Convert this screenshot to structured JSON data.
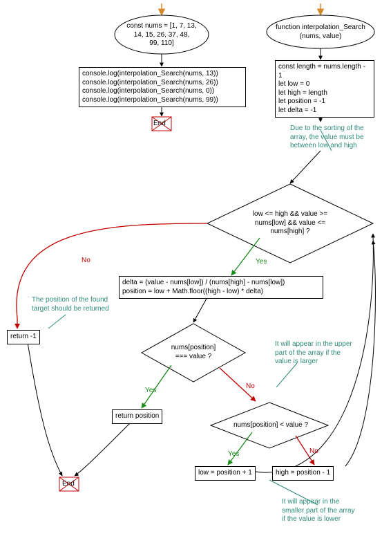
{
  "left": {
    "start_array": "const nums = [1, 7, 13,\n14, 15, 26, 37, 48,\n99, 110]",
    "calls": "console.log(interpolation_Search(nums, 13))\nconsole.log(interpolation_Search(nums, 26))\nconsole.log(interpolation_Search(nums, 0))\nconsole.log(interpolation_Search(nums, 99))",
    "end": "End"
  },
  "right": {
    "func_header": "function interpolation_Search\n(nums, value)",
    "init_block": "const length = nums.length - 1\nlet low = 0\nlet high = length\nlet position = -1\nlet delta = -1"
  },
  "comments": {
    "sort_note": "Due to the sorting of the\narray, the value must be\nbetween low and high",
    "found_note": "The position of the found\ntarget should be returned",
    "upper_note": "It will appear in the upper\npart of the array if the\nvalue is larger",
    "lower_note": "It will appear in the\nsmaller part of the array\nif the value is lower"
  },
  "cond_while": "low <= high && value >=\nnums[low] && value <=\nnums[high] ?",
  "calc_block": "delta = (value - nums[low]) / (nums[high] - nums[low])\nposition = low + Math.floor((high - low) * delta)",
  "cond_match": "nums[position]\n=== value ?",
  "cond_less": "nums[position] < value ?",
  "ret_neg1": "return -1",
  "ret_pos": "return position",
  "low_update": "low = position + 1",
  "high_update": "high = position - 1",
  "edge": {
    "yes": "Yes",
    "no": "No"
  },
  "end": "End",
  "chart_data": {
    "type": "flowchart",
    "nodes": [
      {
        "id": "n_start_left",
        "kind": "terminator",
        "label": "const nums = [1, 7, 13, 14, 15, 26, 37, 48, 99, 110]"
      },
      {
        "id": "n_calls",
        "kind": "process",
        "label": "console.log(interpolation_Search(nums, 13)); console.log(interpolation_Search(nums, 26)); console.log(interpolation_Search(nums, 0)); console.log(interpolation_Search(nums, 99))"
      },
      {
        "id": "n_end_left",
        "kind": "end",
        "label": "End"
      },
      {
        "id": "n_func",
        "kind": "terminator",
        "label": "function interpolation_Search(nums, value)"
      },
      {
        "id": "n_init",
        "kind": "process",
        "label": "const length = nums.length - 1; let low = 0; let high = length; let position = -1; let delta = -1"
      },
      {
        "id": "n_while",
        "kind": "decision",
        "label": "low <= high && value >= nums[low] && value <= nums[high] ?"
      },
      {
        "id": "n_calc",
        "kind": "process",
        "label": "delta = (value - nums[low]) / (nums[high] - nums[low]); position = low + Math.floor((high - low) * delta)"
      },
      {
        "id": "n_match",
        "kind": "decision",
        "label": "nums[position] === value ?"
      },
      {
        "id": "n_retpos",
        "kind": "process",
        "label": "return position"
      },
      {
        "id": "n_less",
        "kind": "decision",
        "label": "nums[position] < value ?"
      },
      {
        "id": "n_low",
        "kind": "process",
        "label": "low = position + 1"
      },
      {
        "id": "n_high",
        "kind": "process",
        "label": "high = position - 1"
      },
      {
        "id": "n_retneg1",
        "kind": "process",
        "label": "return -1"
      },
      {
        "id": "n_end_right",
        "kind": "end",
        "label": "End"
      }
    ],
    "edges": [
      {
        "from": "n_start_left",
        "to": "n_calls"
      },
      {
        "from": "n_calls",
        "to": "n_end_left"
      },
      {
        "from": "n_func",
        "to": "n_init"
      },
      {
        "from": "n_init",
        "to": "n_while"
      },
      {
        "from": "n_while",
        "to": "n_calc",
        "label": "Yes"
      },
      {
        "from": "n_while",
        "to": "n_retneg1",
        "label": "No"
      },
      {
        "from": "n_calc",
        "to": "n_match"
      },
      {
        "from": "n_match",
        "to": "n_retpos",
        "label": "Yes"
      },
      {
        "from": "n_match",
        "to": "n_less",
        "label": "No"
      },
      {
        "from": "n_less",
        "to": "n_low",
        "label": "Yes"
      },
      {
        "from": "n_less",
        "to": "n_high",
        "label": "No"
      },
      {
        "from": "n_low",
        "to": "n_while"
      },
      {
        "from": "n_high",
        "to": "n_while"
      },
      {
        "from": "n_retpos",
        "to": "n_end_right"
      },
      {
        "from": "n_retneg1",
        "to": "n_end_right"
      }
    ],
    "comments": [
      {
        "attach": "n_while",
        "text": "Due to the sorting of the array, the value must be between low and high"
      },
      {
        "attach": "n_retneg1",
        "text": "The position of the found target should be returned"
      },
      {
        "attach": "n_less",
        "text": "It will appear in the upper part of the array if the value is larger"
      },
      {
        "attach": "n_low",
        "text": "It will appear in the smaller part of the array if the value is lower"
      }
    ]
  }
}
